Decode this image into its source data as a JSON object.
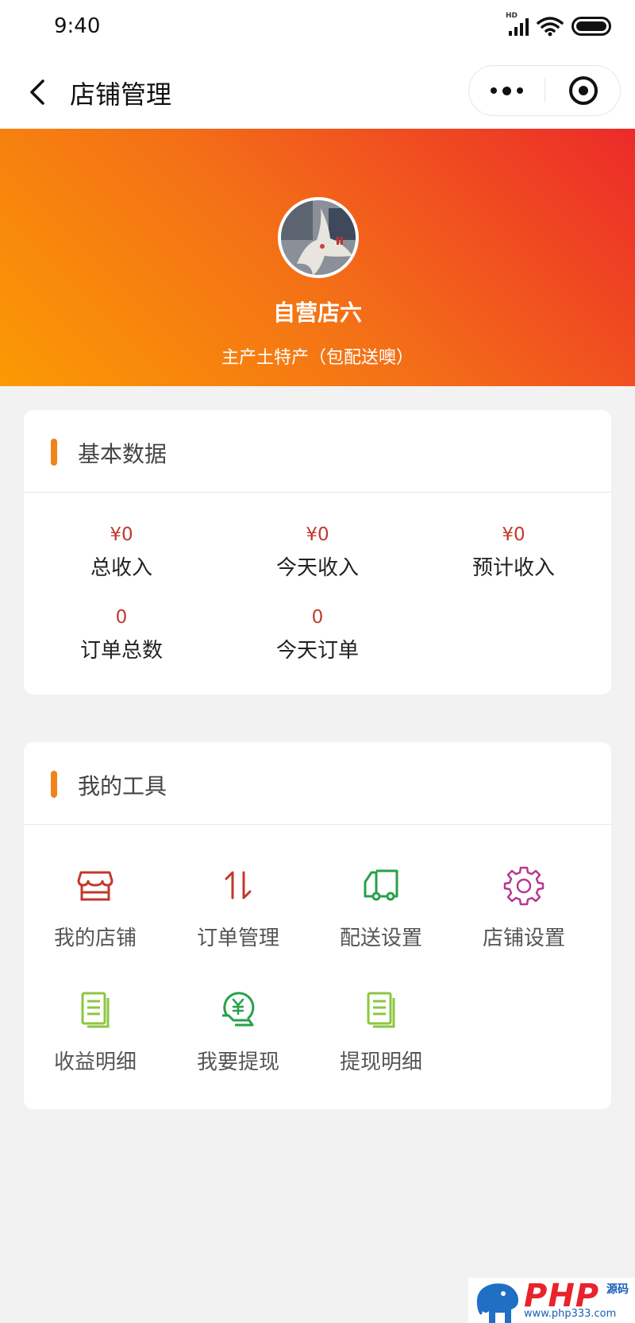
{
  "status_bar": {
    "time": "9:40",
    "signal_tag": "HD"
  },
  "nav": {
    "title": "店铺管理"
  },
  "shop": {
    "name": "自营店六",
    "description": "主产土特产（包配送噢）"
  },
  "basic_data": {
    "title": "基本数据",
    "stats": [
      {
        "value": "¥0",
        "label": "总收入"
      },
      {
        "value": "¥0",
        "label": "今天收入"
      },
      {
        "value": "¥0",
        "label": "预计收入"
      },
      {
        "value": "0",
        "label": "订单总数"
      },
      {
        "value": "0",
        "label": "今天订单"
      }
    ]
  },
  "tools": {
    "title": "我的工具",
    "items": [
      {
        "label": "我的店铺",
        "icon": "store-icon",
        "color": "#c0392b"
      },
      {
        "label": "订单管理",
        "icon": "sort-arrows-icon",
        "color": "#c0392b"
      },
      {
        "label": "配送设置",
        "icon": "delivery-truck-icon",
        "color": "#27a14a"
      },
      {
        "label": "店铺设置",
        "icon": "gear-icon",
        "color": "#b8388f"
      },
      {
        "label": "收益明细",
        "icon": "document-list-icon",
        "color": "#8cc63f"
      },
      {
        "label": "我要提现",
        "icon": "yuan-withdraw-icon",
        "color": "#27a14a"
      },
      {
        "label": "提现明细",
        "icon": "document-list-icon",
        "color": "#8cc63f"
      }
    ]
  },
  "colors": {
    "accent": "#f08319",
    "hero_start": "#fb9a03",
    "hero_end": "#ec2a29",
    "value_red": "#c0392b"
  },
  "watermark": {
    "brand": "PHP",
    "brand_sub": "源码",
    "url": "www.php333.com"
  }
}
